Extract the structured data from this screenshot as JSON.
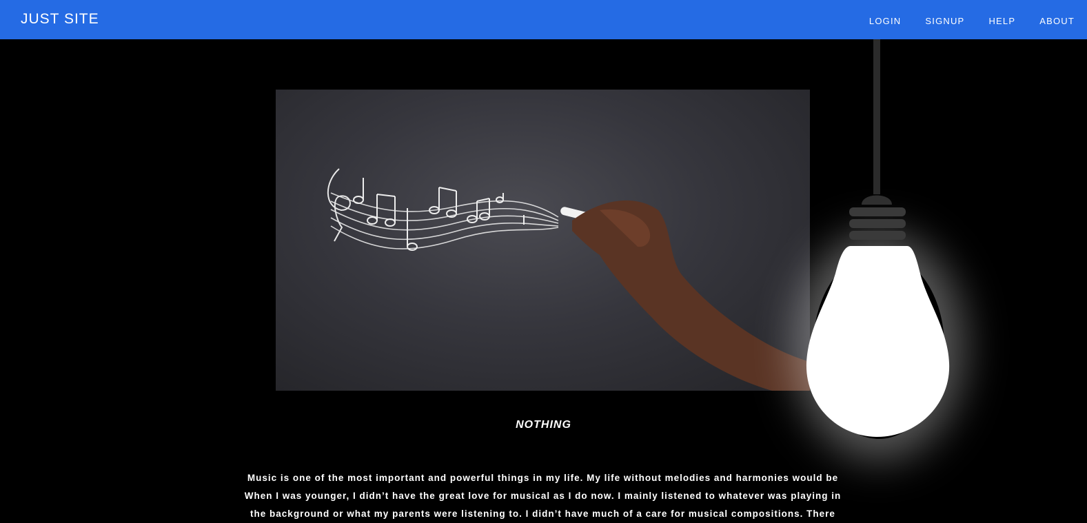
{
  "header": {
    "brand": "JUST SITE",
    "nav": [
      {
        "label": "LOGIN"
      },
      {
        "label": "SIGNUP"
      },
      {
        "label": "HELP"
      },
      {
        "label": "ABOUT"
      }
    ]
  },
  "main": {
    "hero_image_alt": "hand drawing music notes on a chalkboard",
    "caption": "NOTHING",
    "paragraph_lines": [
      "Music is one of the most important and powerful things in my life. My life without melodies and harmonies would be",
      "When I was younger, I didn’t have the great love for musical as I do now. I mainly listened to whatever was playing in",
      "the background or what my parents were listening to. I didn’t have much of a care for musical compositions. There"
    ]
  },
  "colors": {
    "header_bg": "#256be4",
    "page_bg": "#000000",
    "text": "#ffffff"
  }
}
